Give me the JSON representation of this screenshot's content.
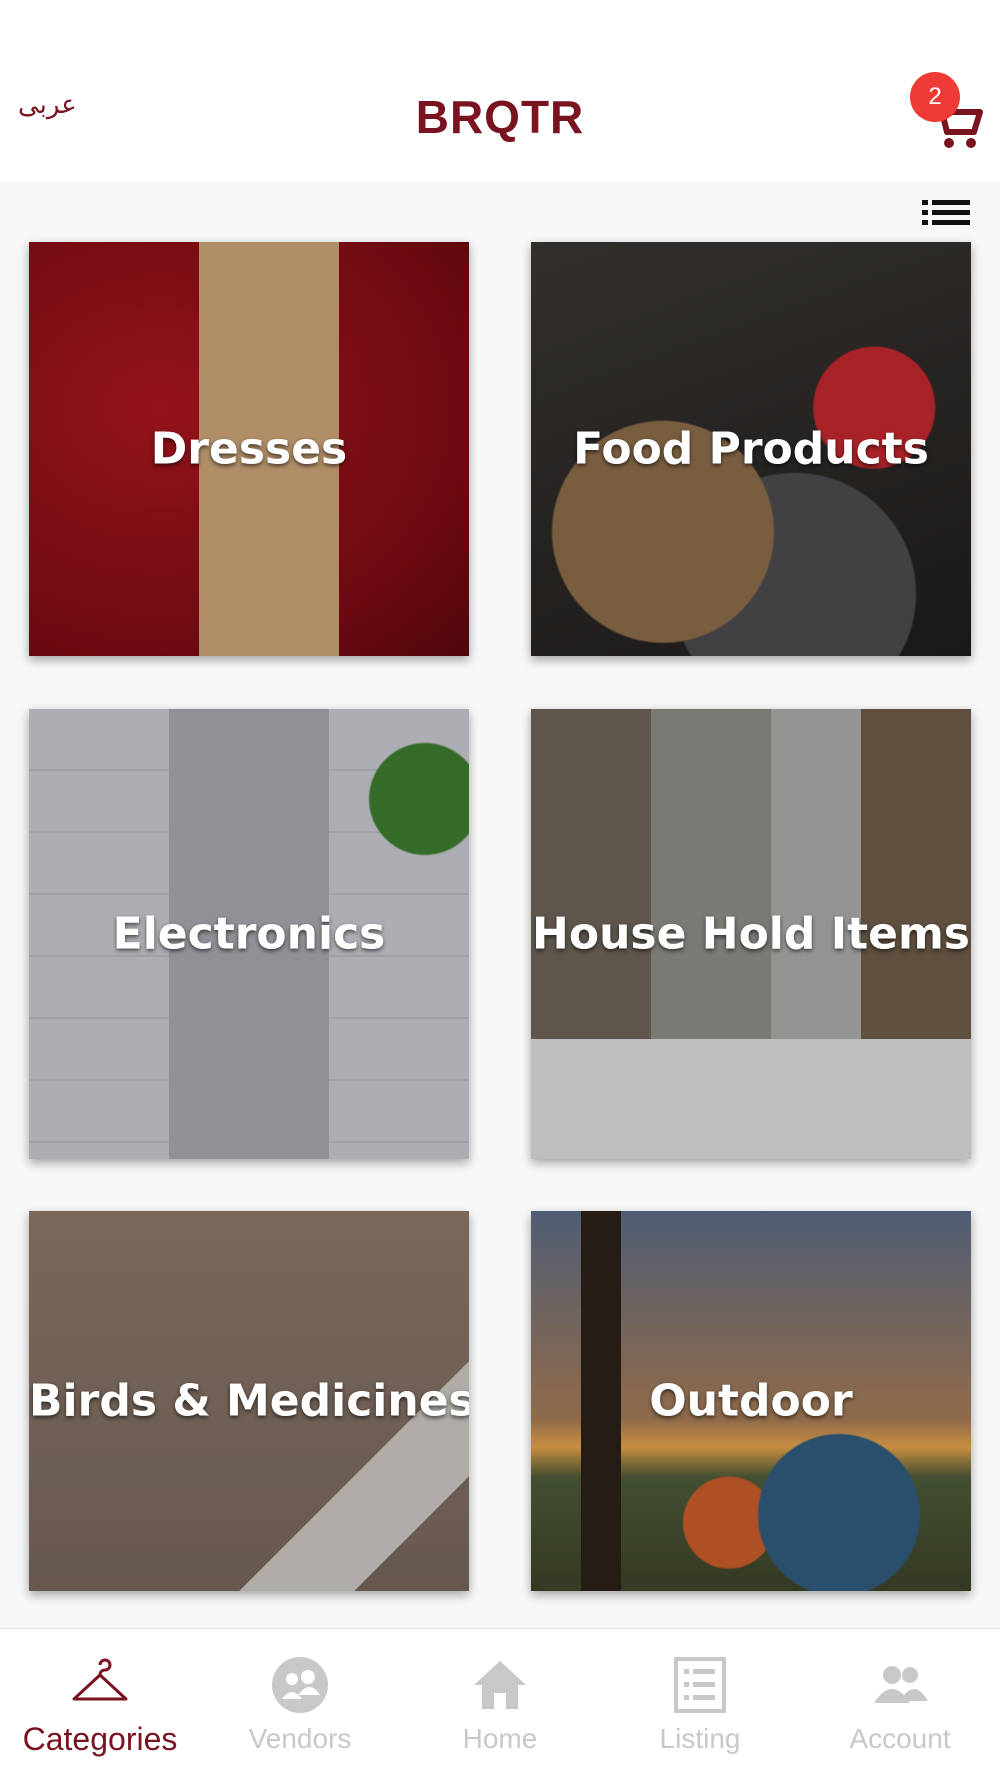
{
  "header": {
    "language_toggle": "عربى",
    "app_title": "BRQTR",
    "cart_count": "2"
  },
  "categories": [
    {
      "label": "Dresses"
    },
    {
      "label": "Food Products"
    },
    {
      "label": "Electronics"
    },
    {
      "label": "House Hold Items"
    },
    {
      "label": "Birds & Medicines"
    },
    {
      "label": "Outdoor"
    }
  ],
  "tabs": [
    {
      "label": "Categories",
      "icon": "hanger-icon",
      "active": true
    },
    {
      "label": "Vendors",
      "icon": "vendors-icon",
      "active": false
    },
    {
      "label": "Home",
      "icon": "home-icon",
      "active": false
    },
    {
      "label": "Listing",
      "icon": "listing-icon",
      "active": false
    },
    {
      "label": "Account",
      "icon": "account-icon",
      "active": false
    }
  ],
  "colors": {
    "brand": "#7a1320",
    "badge": "#ee3b35",
    "inactive_tab": "#c8c8c8"
  }
}
